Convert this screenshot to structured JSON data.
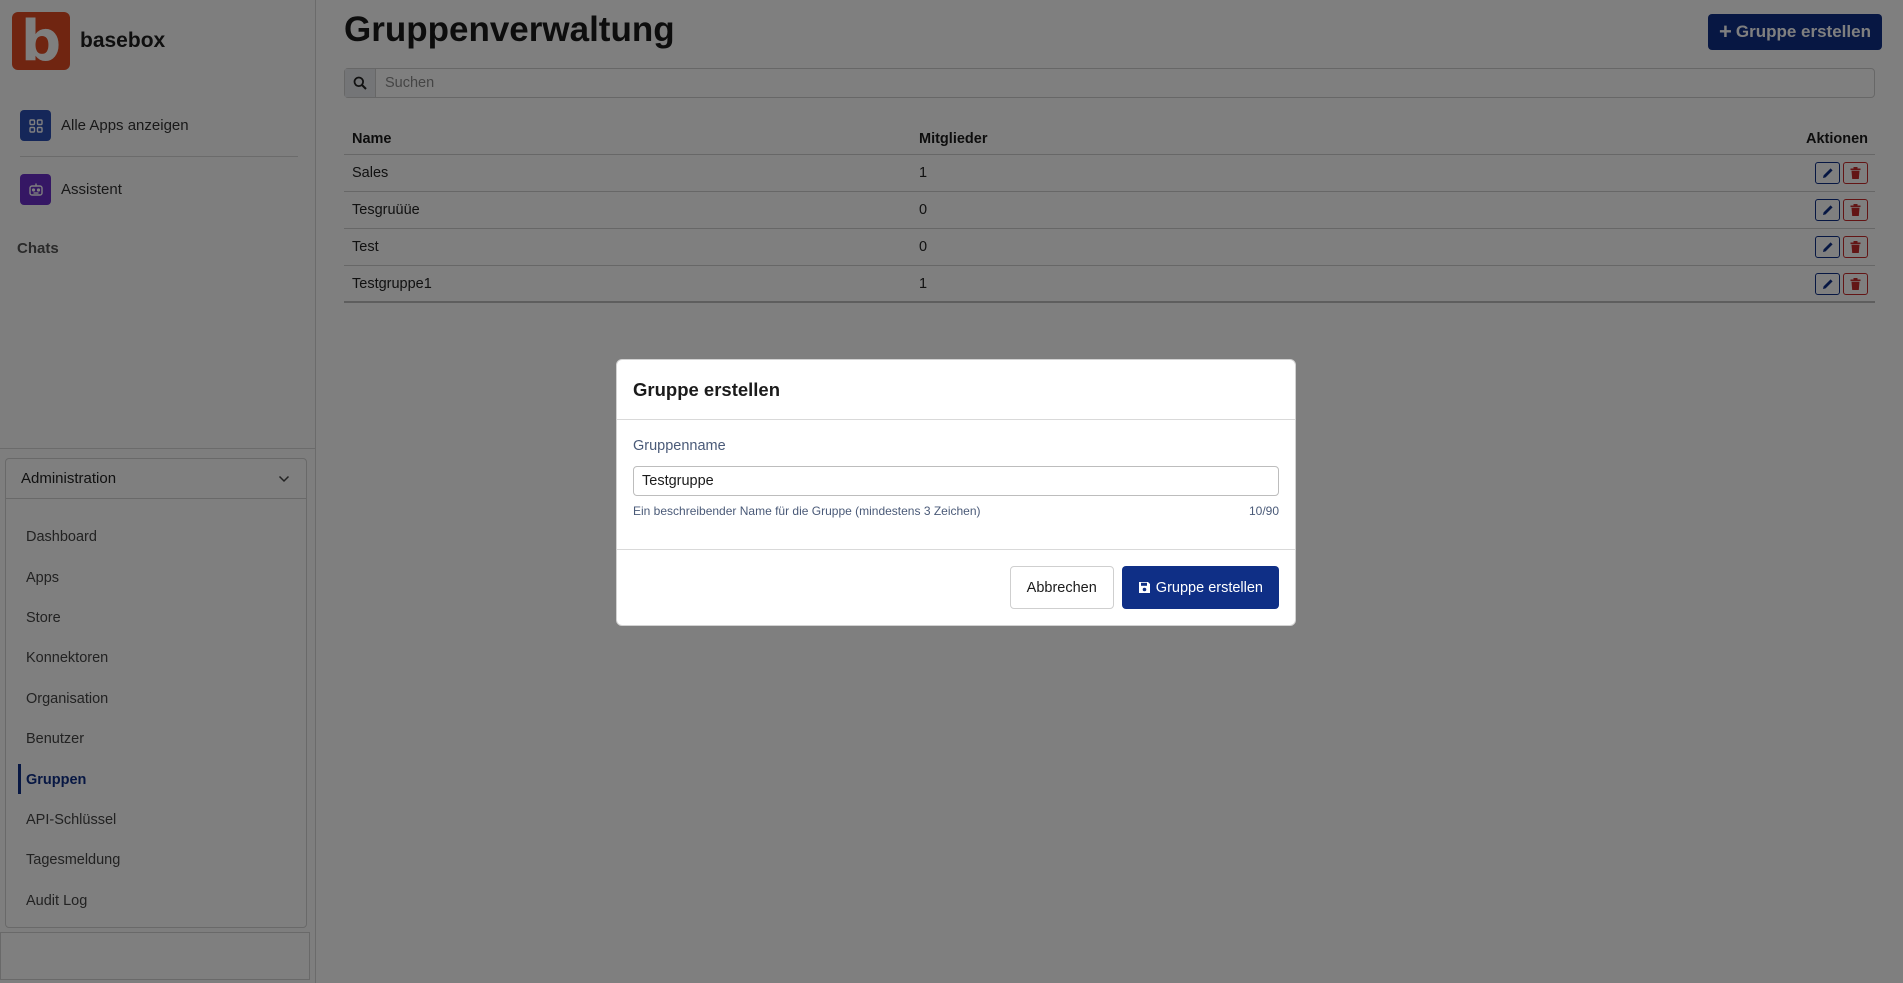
{
  "brand": {
    "logo_letter": "b",
    "name": "basebox",
    "logo_color": "#e04a23"
  },
  "sidebar": {
    "top_items": [
      {
        "label": "Alle Apps anzeigen",
        "icon": "grid-icon"
      },
      {
        "label": "Assistent",
        "icon": "robot-icon"
      }
    ],
    "chats_label": "Chats",
    "admin": {
      "header": "Administration",
      "items": [
        {
          "label": "Dashboard"
        },
        {
          "label": "Apps"
        },
        {
          "label": "Store"
        },
        {
          "label": "Konnektoren"
        },
        {
          "label": "Organisation"
        },
        {
          "label": "Benutzer"
        },
        {
          "label": "Gruppen",
          "active": true
        },
        {
          "label": "API-Schlüssel"
        },
        {
          "label": "Tagesmeldung"
        },
        {
          "label": "Audit Log"
        }
      ]
    }
  },
  "main": {
    "title": "Gruppenverwaltung",
    "create_button": "Gruppe erstellen",
    "search_placeholder": "Suchen",
    "table": {
      "headers": {
        "name": "Name",
        "members": "Mitglieder",
        "actions": "Aktionen"
      },
      "rows": [
        {
          "name": "Sales",
          "members": "1"
        },
        {
          "name": "Tesgruüüe",
          "members": "0"
        },
        {
          "name": "Test",
          "members": "0"
        },
        {
          "name": "Testgruppe1",
          "members": "1"
        }
      ]
    }
  },
  "modal": {
    "title": "Gruppe erstellen",
    "field_label": "Gruppenname",
    "field_value": "Testgruppe",
    "help_text": "Ein beschreibender Name für die Gruppe (mindestens 3 Zeichen)",
    "char_count": "10/90",
    "cancel_label": "Abbrechen",
    "submit_label": "Gruppe erstellen"
  },
  "colors": {
    "accent": "#0f2f86",
    "danger": "#c62b2b"
  }
}
